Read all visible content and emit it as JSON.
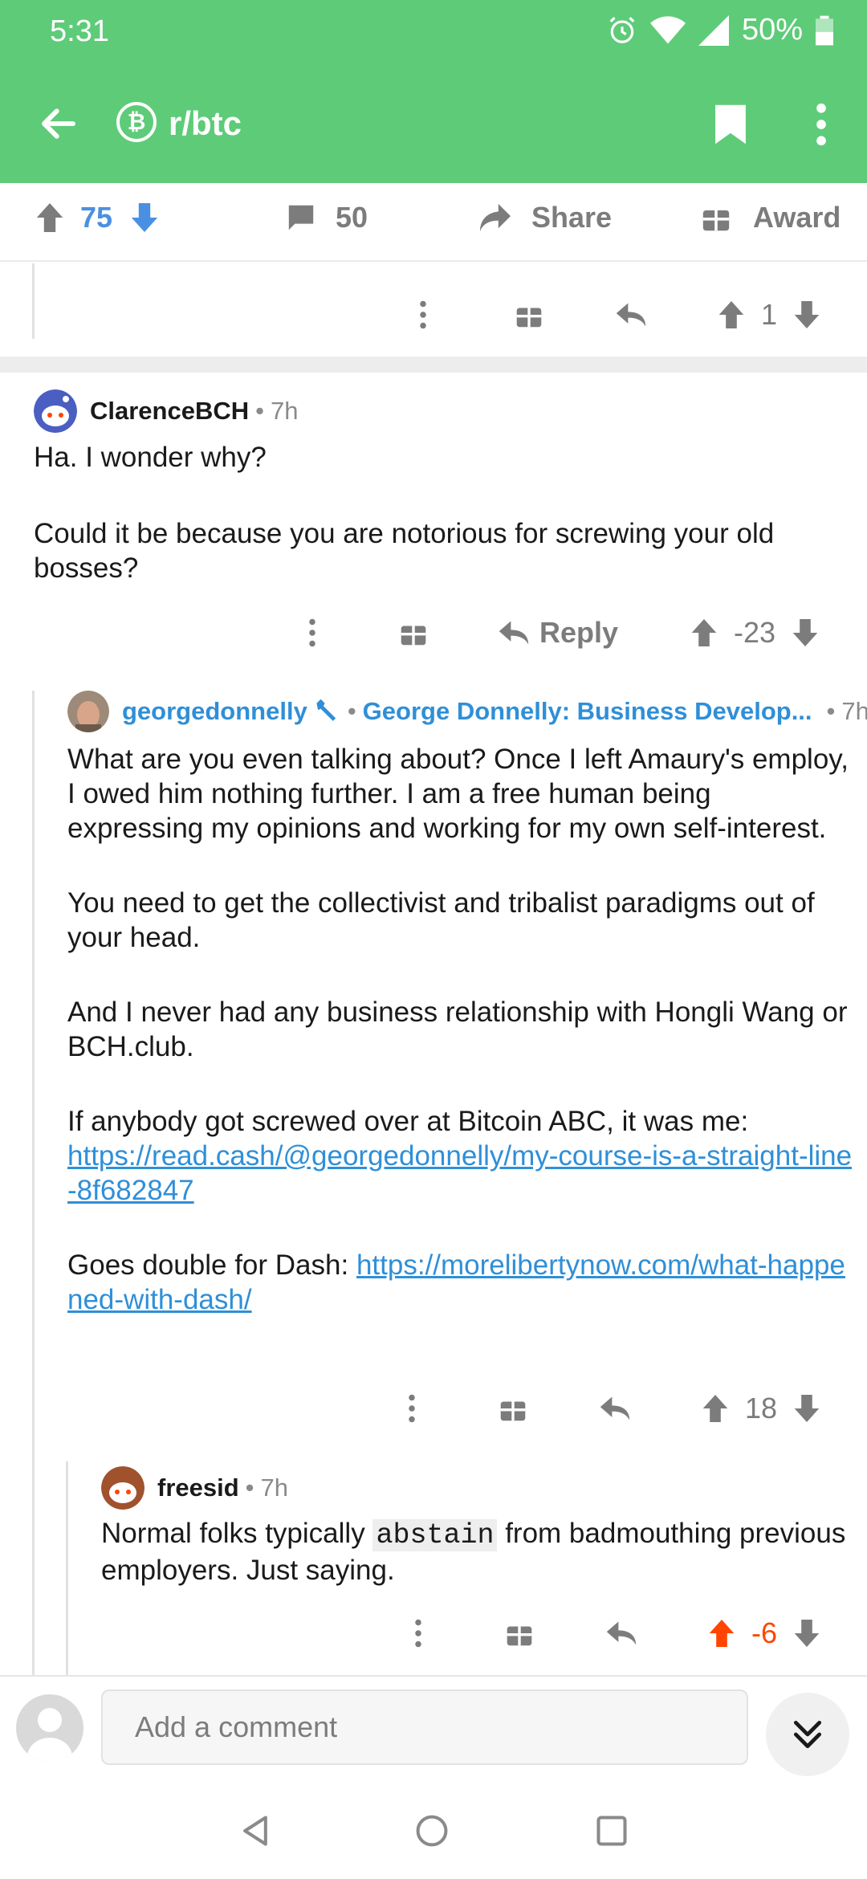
{
  "status_bar": {
    "time": "5:31",
    "battery": "50%"
  },
  "header": {
    "subreddit": "r/btc"
  },
  "post_actions": {
    "score": "75",
    "comments": "50",
    "share_label": "Share",
    "award_label": "Award"
  },
  "prev_comment": {
    "score": "1"
  },
  "comments": [
    {
      "user": "ClarenceBCH",
      "time": "7h",
      "paragraphs": [
        "Ha. I wonder why?",
        "Could it be because you are notorious for screwing your old bosses?"
      ],
      "reply_label": "Reply",
      "score": "-23"
    },
    {
      "user": "georgedonnelly",
      "flair": "George Donnelly: Business Develop...",
      "time": "7h",
      "p1": "What are you even talking about? Once I left Amaury's employ, I owed him nothing further. I am a free human being expressing my opinions and working for my own self-interest.",
      "p2": "You need to get the collectivist and tribalist paradigms out of your head.",
      "p3": "And I never had any business relationship with Hongli Wang or BCH.club.",
      "p4_text": "If anybody got screwed over at Bitcoin ABC, it was me:",
      "p4_link": "https://read.cash/@georgedonnelly/my-course-is-a-straight-line-8f682847",
      "p5_text": "Goes double for Dash:",
      "p5_link": "https://morelibertynow.com/what-happened-with-dash/",
      "score": "18"
    },
    {
      "user": "freesid",
      "time": "7h",
      "text_before": "Normal folks typically",
      "code": "abstain",
      "text_after": "from badmouthing previous employers.  Just saying.",
      "score": "-6"
    }
  ],
  "composer": {
    "placeholder": "Add a comment"
  },
  "colors": {
    "header_green": "#5ecb78",
    "upvote_blue": "#4a90e2",
    "upvote_orange": "#ff4500",
    "link_blue": "#2f8fd8"
  }
}
